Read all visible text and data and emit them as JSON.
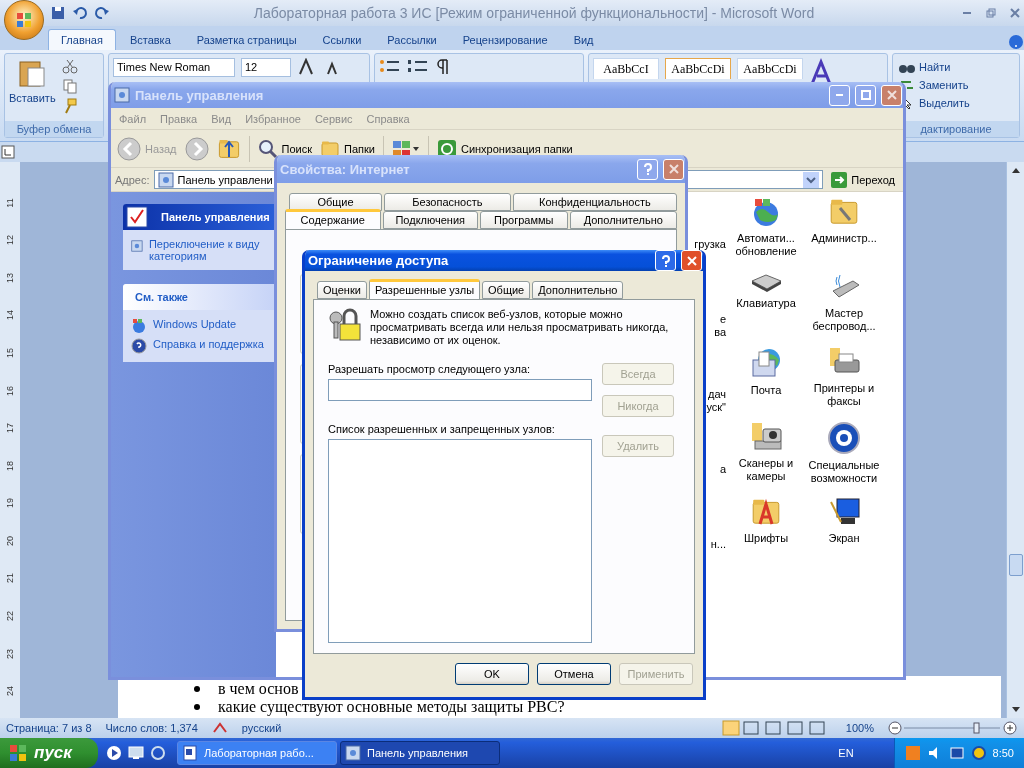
{
  "word": {
    "title": "Лабораторная работа 3 ИС [Режим ограниченной функциональности] - Microsoft Word",
    "tabs": [
      {
        "label": "Главная",
        "selected": true
      },
      {
        "label": "Вставка",
        "selected": false
      },
      {
        "label": "Разметка страницы",
        "selected": false
      },
      {
        "label": "Ссылки",
        "selected": false
      },
      {
        "label": "Рассылки",
        "selected": false
      },
      {
        "label": "Рецензирование",
        "selected": false
      },
      {
        "label": "Вид",
        "selected": false
      }
    ],
    "ribbon": {
      "paste": "Вставить",
      "clipboard_group": "Буфер обмена",
      "font": "Times New Roman",
      "size": "12",
      "styles": [
        "AaBbCcI",
        "AaBbCcDi",
        "AaBbCcDi"
      ],
      "find": "Найти",
      "replace": "Заменить",
      "select": "Выделить",
      "editing_group": "дактирование"
    },
    "ruler_numbers": [
      "11",
      "12",
      "13",
      "14",
      "15",
      "16",
      "17",
      "18",
      "19",
      "20",
      "21",
      "22",
      "23",
      "24"
    ],
    "document": {
      "bullets": [
        "в чем основ",
        "какие существуют основные методы защиты РВС?"
      ]
    },
    "status_bar": {
      "page": "Страница: 7 из 8",
      "words": "Число слов: 1,374",
      "language": "русский",
      "zoom": "100%"
    }
  },
  "control_panel": {
    "title": "Панель управления",
    "menu": [
      "Файл",
      "Правка",
      "Вид",
      "Избранное",
      "Сервис",
      "Справка"
    ],
    "toolbar": {
      "back": "Назад",
      "search": "Поиск",
      "folders": "Папки",
      "sync": "Синхронизация папки"
    },
    "address_label": "Адрес:",
    "address": "Панель управлени",
    "go": "Переход",
    "sidebar": {
      "header": "Панель управления",
      "switch_link": "Переключение к виду категориям",
      "see_also": "См. также",
      "links": [
        "Windows Update",
        "Справка и поддержка"
      ]
    },
    "partial_items": [
      "грузка",
      "е\nва",
      "дач\nуск\"",
      "а",
      "н..."
    ],
    "items": [
      {
        "label": "Автомати... обновление"
      },
      {
        "label": "Администр..."
      },
      {
        "label": "Клавиатура"
      },
      {
        "label": "Мастер беспровод..."
      },
      {
        "label": "Почта"
      },
      {
        "label": "Принтеры и факсы"
      },
      {
        "label": "Сканеры и камеры"
      },
      {
        "label": "Специальные возможности"
      },
      {
        "label": "Шрифты"
      },
      {
        "label": "Экран"
      }
    ]
  },
  "internet_properties": {
    "title": "Свойства: Интернет",
    "tabs_row_1": [
      {
        "label": "Общие",
        "selected": false
      },
      {
        "label": "Безопасность",
        "selected": false
      },
      {
        "label": "Конфиденциальность",
        "selected": false
      }
    ],
    "tabs_row_2": [
      {
        "label": "Содержание",
        "selected": true
      },
      {
        "label": "Подключения",
        "selected": false
      },
      {
        "label": "Программы",
        "selected": false
      },
      {
        "label": "Дополнительно",
        "selected": false
      }
    ]
  },
  "content_advisor": {
    "title": "Ограничение доступа",
    "tabs": [
      {
        "label": "Оценки",
        "selected": false
      },
      {
        "label": "Разрешенные узлы",
        "selected": true
      },
      {
        "label": "Общие",
        "selected": false
      },
      {
        "label": "Дополнительно",
        "selected": false
      }
    ],
    "description": "Можно создать список веб-узлов, которые можно просматривать всегда или нельзя просматривать никогда, независимо от их оценок.",
    "site_label": "Разрешать просмотр следующего узла:",
    "list_label": "Список разрешенных и запрещенных узлов:",
    "side_buttons": [
      {
        "label": "Всегда",
        "disabled": true
      },
      {
        "label": "Никогда",
        "disabled": true
      },
      {
        "label": "Удалить",
        "disabled": true
      }
    ],
    "footer_buttons": [
      {
        "label": "OK",
        "disabled": false
      },
      {
        "label": "Отмена",
        "disabled": false
      },
      {
        "label": "Применить",
        "disabled": true
      }
    ]
  },
  "taskbar": {
    "start": "пуск",
    "tasks": [
      {
        "label": "Лабораторная рабо...",
        "selected": false
      },
      {
        "label": "Панель управления",
        "selected": true
      }
    ],
    "language": "EN",
    "clock": "8:50"
  }
}
